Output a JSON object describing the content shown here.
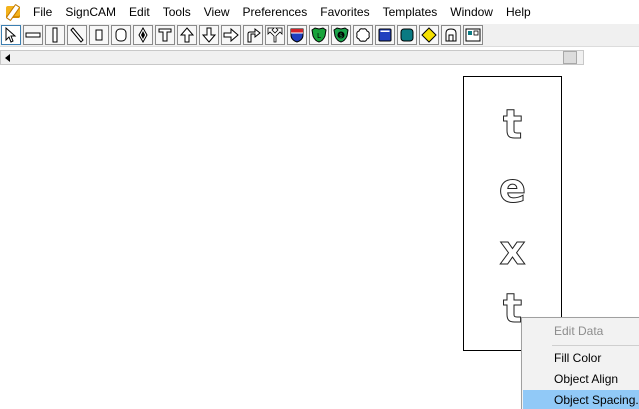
{
  "app": {
    "icon": "signcam-app-icon",
    "menu": [
      "File",
      "SignCAM",
      "Edit",
      "Tools",
      "View",
      "Preferences",
      "Favorites",
      "Templates",
      "Window",
      "Help"
    ]
  },
  "toolbar": {
    "tools": [
      {
        "name": "select-pointer-icon",
        "active": true
      },
      {
        "name": "horizontal-rectangle-icon"
      },
      {
        "name": "vertical-rectangle-icon"
      },
      {
        "name": "diagonal-line-icon"
      },
      {
        "name": "small-rectangle-icon"
      },
      {
        "name": "rounded-rectangle-icon"
      },
      {
        "name": "diamond-icon"
      },
      {
        "name": "text-tool-icon"
      },
      {
        "name": "arrow-up-icon"
      },
      {
        "name": "arrow-down-icon"
      },
      {
        "name": "arrow-right-icon"
      },
      {
        "name": "arrow-turn-right-icon"
      },
      {
        "name": "arrow-split-icon"
      },
      {
        "name": "interstate-shield-icon",
        "color": "#d2232a"
      },
      {
        "name": "green-shield-icon",
        "color": "#18a33a"
      },
      {
        "name": "green-dollar-shield-icon",
        "color": "#1aa34a"
      },
      {
        "name": "cloud-shape-icon"
      },
      {
        "name": "blue-rectangle-icon",
        "color": "#1f3fbf"
      },
      {
        "name": "teal-rounded-square-icon",
        "color": "#0a7a82"
      },
      {
        "name": "yellow-diamond-icon",
        "color": "#f5e100"
      },
      {
        "name": "tombstone-shape-icon"
      },
      {
        "name": "panel-layout-icon"
      }
    ]
  },
  "canvas": {
    "sign_letters": [
      "t",
      "e",
      "x",
      "t"
    ]
  },
  "context_menu": {
    "items": [
      {
        "label": "Edit Data",
        "disabled": true
      },
      {
        "label": "Fill Color"
      },
      {
        "label": "Object Align"
      },
      {
        "label": "Object Spacing...",
        "hover": true
      }
    ],
    "hover_color": "#91c9f7"
  }
}
